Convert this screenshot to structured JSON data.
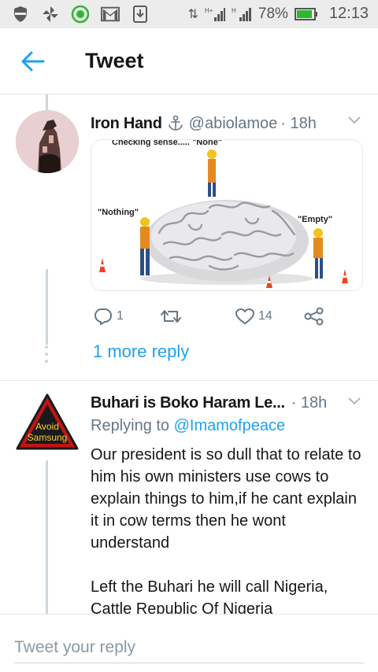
{
  "status_bar": {
    "battery": "78%",
    "time": "12:13",
    "notif_icons": [
      "vpn-shield-icon",
      "pinwheel-icon",
      "green-circle-app-icon",
      "gmail-icon",
      "download-icon"
    ],
    "signal_labels": [
      "1",
      "H+",
      "H"
    ]
  },
  "app_bar": {
    "title": "Tweet",
    "back_icon": "back-arrow-icon"
  },
  "tweet1": {
    "author_name": "Iron Hand",
    "badge_icon": "anchor-icon",
    "handle": "@abiolamoe",
    "time": "· 18h",
    "media_labels": {
      "top": "Checking sense..... \"None\"",
      "left": "\"Nothing\"",
      "right": "\"Empty\""
    },
    "replies": "1",
    "retweets": "",
    "likes": "14",
    "more_reply": "1 more reply"
  },
  "tweet2": {
    "author_name": "Buhari is Boko Haram Le...",
    "avatar_text_1": "Avoid",
    "avatar_text_2": "Samsung",
    "time": "· 18h",
    "replying_prefix": "Replying to",
    "replying_mention": "@Imamofpeace",
    "paragraph1": "Our president is so dull that to relate to him his own ministers use cows to explain things to him,if he cant explain it in cow terms then he wont understand",
    "paragraph2": "Left the Buhari he will call Nigeria, Cattle Republic Of Nigeria"
  },
  "reply_bar": {
    "placeholder": "Tweet your reply"
  },
  "colors": {
    "accent": "#1da1f2",
    "secondary_text": "#657786",
    "divider": "#e1e8ed"
  }
}
